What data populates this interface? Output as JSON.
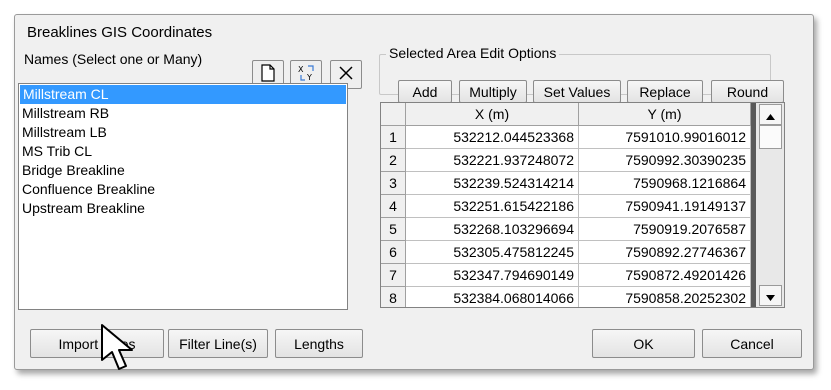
{
  "window": {
    "title": "Breaklines GIS Coordinates"
  },
  "names": {
    "label": "Names (Select one or Many)",
    "items": [
      "Millstream CL",
      "Millstream RB",
      "Millstream LB",
      "MS Trib CL",
      "Bridge Breakline",
      "Confluence Breakline",
      "Upstream Breakline"
    ],
    "selected_index": 0
  },
  "toolbar_icons": [
    "new-document-icon",
    "xy-coordinates-icon",
    "delete-x-icon"
  ],
  "edit_options": {
    "legend": "Selected Area Edit Options",
    "buttons": [
      "Add",
      "Multiply",
      "Set Values",
      "Replace",
      "Round"
    ]
  },
  "grid": {
    "columns": [
      "X (m)",
      "Y (m)"
    ],
    "rows": [
      {
        "n": "1",
        "x": "532212.044523368",
        "y": "7591010.99016012"
      },
      {
        "n": "2",
        "x": "532221.937248072",
        "y": "7590992.30390235"
      },
      {
        "n": "3",
        "x": "532239.524314214",
        "y": "7590968.1216864"
      },
      {
        "n": "4",
        "x": "532251.615422186",
        "y": "7590941.19149137"
      },
      {
        "n": "5",
        "x": "532268.103296694",
        "y": "7590919.2076587"
      },
      {
        "n": "6",
        "x": "532305.475812245",
        "y": "7590892.27746367"
      },
      {
        "n": "7",
        "x": "532347.794690149",
        "y": "7590872.49201426"
      },
      {
        "n": "8",
        "x": "532384.068014066",
        "y": "7590858.20252302"
      }
    ]
  },
  "bottom_buttons": {
    "import": "Import Lines",
    "filter": "Filter Line(s)",
    "lengths": "Lengths",
    "ok": "OK",
    "cancel": "Cancel"
  }
}
